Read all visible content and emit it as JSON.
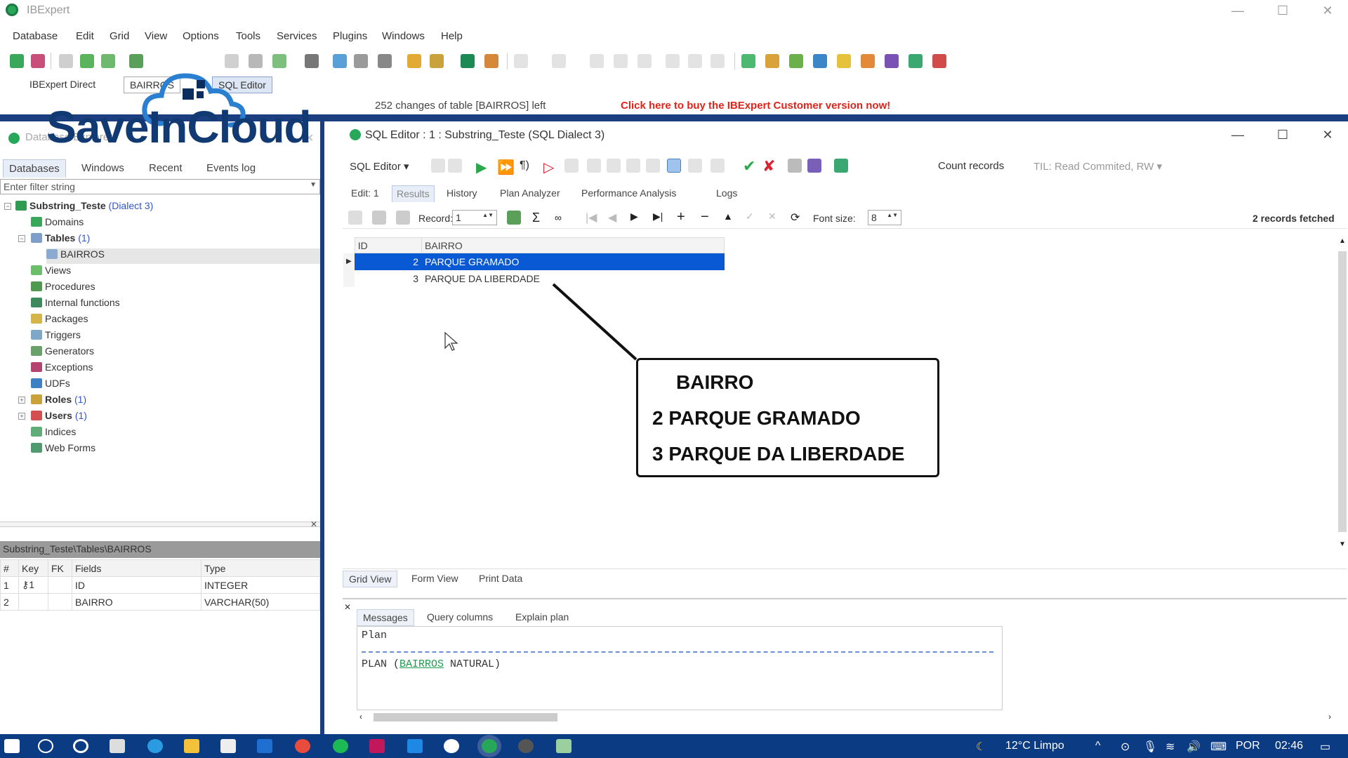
{
  "app": {
    "title": "IBExpert",
    "buy_notice": "Click here to buy the IBExpert Customer version now!",
    "changes_notice": "252 changes of table [BAIRROS] left"
  },
  "menu": [
    "Database",
    "Edit",
    "Grid",
    "View",
    "Options",
    "Tools",
    "Services",
    "Plugins",
    "Windows",
    "Help"
  ],
  "window_tabs": [
    "IBExpert Direct",
    "BAIRROS",
    "SQL Editor"
  ],
  "logo": {
    "text": "SaveInCloud"
  },
  "explorer": {
    "title": "Database Explorer",
    "tabs": [
      "Databases",
      "Windows",
      "Recent",
      "Events log"
    ],
    "filter_placeholder": "Enter filter string",
    "db_name": "Substring_Teste",
    "db_dialect": "(Dialect 3)",
    "tree": [
      {
        "label": "Domains",
        "count": ""
      },
      {
        "label": "Tables",
        "count": "(1)"
      },
      {
        "label": "BAIRROS",
        "count": ""
      },
      {
        "label": "Views",
        "count": ""
      },
      {
        "label": "Procedures",
        "count": ""
      },
      {
        "label": "Internal functions",
        "count": ""
      },
      {
        "label": "Packages",
        "count": ""
      },
      {
        "label": "Triggers",
        "count": ""
      },
      {
        "label": "Generators",
        "count": ""
      },
      {
        "label": "Exceptions",
        "count": ""
      },
      {
        "label": "UDFs",
        "count": ""
      },
      {
        "label": "Roles",
        "count": "(1)"
      },
      {
        "label": "Users",
        "count": "(1)"
      },
      {
        "label": "Indices",
        "count": ""
      },
      {
        "label": "Web Forms",
        "count": ""
      }
    ],
    "path": "Substring_Teste\\Tables\\BAIRROS",
    "field_headers": [
      "#",
      "Key",
      "FK",
      "Fields",
      "Type"
    ],
    "fields": [
      {
        "n": "1",
        "key": "⚷1",
        "fk": "",
        "name": "ID",
        "type": "INTEGER"
      },
      {
        "n": "2",
        "key": "",
        "fk": "",
        "name": "BAIRRO",
        "type": "VARCHAR(50)"
      }
    ]
  },
  "editor": {
    "title": "SQL Editor : 1 : Substring_Teste (SQL Dialect 3)",
    "sql_editor_button": "SQL Editor",
    "count_records": "Count records",
    "til": "TIL: Read Commited, RW",
    "tabs": [
      "Edit: 1",
      "Results",
      "History",
      "Plan Analyzer",
      "Performance Analysis",
      "Logs"
    ],
    "record_label": "Record:",
    "record_value": "1",
    "font_label": "Font size:",
    "font_value": "8",
    "fetched": "2 records fetched",
    "columns": [
      "ID",
      "BAIRRO"
    ],
    "rows": [
      {
        "id": "2",
        "bairro": "PARQUE GRAMADO"
      },
      {
        "id": "3",
        "bairro": "PARQUE DA LIBERDADE"
      }
    ],
    "view_tabs": [
      "Grid View",
      "Form View",
      "Print Data"
    ],
    "msg_tabs": [
      "Messages",
      "Query columns",
      "Explain plan"
    ],
    "plan_header": "Plan",
    "plan_prefix": "PLAN (",
    "plan_table": "BAIRROS",
    "plan_suffix": " NATURAL)"
  },
  "callout": {
    "line1": "BAIRRO",
    "line2": "2 PARQUE GRAMADO",
    "line3": "3 PARQUE DA LIBERDADE"
  },
  "taskbar": {
    "weather": "12°C  Limpo",
    "lang": "POR",
    "time": "02:46"
  },
  "colors": {
    "accent": "#0a59d4",
    "frame": "#1b3e80",
    "taskbar": "#0b3b83",
    "buy": "#e0241a"
  }
}
